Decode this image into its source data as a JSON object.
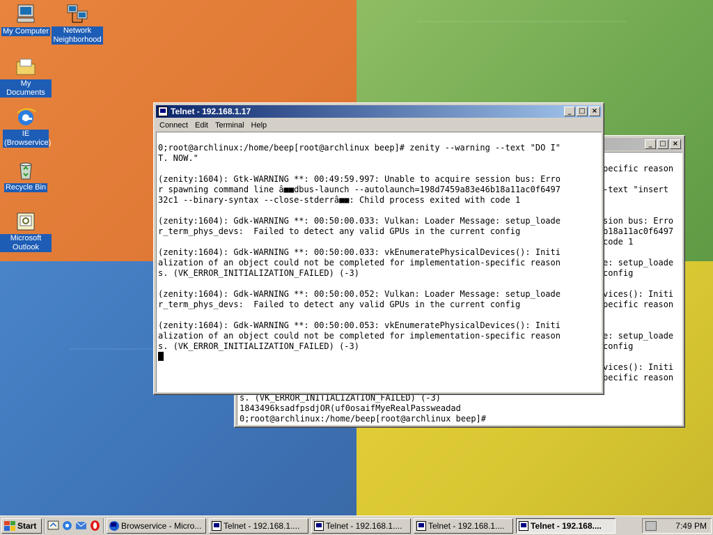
{
  "desktop": {
    "icons": [
      {
        "label": "My Computer"
      },
      {
        "label": "Network Neighborhood"
      },
      {
        "label": "My Documents"
      },
      {
        "label": "IE (Browservice)"
      },
      {
        "label": "Recycle Bin"
      },
      {
        "label": "Microsoft Outlook"
      }
    ]
  },
  "back_window": {
    "title": "",
    "lines": [
      "pecific reason",
      "",
      "-text \"insert",
      "",
      "",
      "sion bus: Erro",
      "b18a11ac0f6497",
      "code 1",
      "",
      "e: setup_loade",
      "config",
      "",
      "vices(): Initi",
      "pecific reason",
      "",
      "",
      "e: setup_loade",
      "config",
      "",
      "vices(): Initi",
      "pecific reason",
      "s. (VK_ERROR_INITIALIZATION_FAILED) (-3)",
      "1843496ksadfpsdjOR(uf0osaifMyeRealPassweadad",
      "0;root@archlinux:/home/beep[root@archlinux beep]#"
    ]
  },
  "front_window": {
    "title": "Telnet - 192.168.1.17",
    "menu": [
      "Connect",
      "Edit",
      "Terminal",
      "Help"
    ],
    "lines": [
      "",
      "0;root@archlinux:/home/beep[root@archlinux beep]# zenity --warning --text \"DO I\"",
      "T. NOW.\"",
      "",
      "(zenity:1604): Gtk-WARNING **: 00:49:59.997: Unable to acquire session bus: Erro",
      "r spawning command line â■■dbus-launch --autolaunch=198d7459a83e46b18a11ac0f6497",
      "32c1 --binary-syntax --close-stderrâ■■: Child process exited with code 1",
      "",
      "(zenity:1604): Gdk-WARNING **: 00:50:00.033: Vulkan: Loader Message: setup_loade",
      "r_term_phys_devs:  Failed to detect any valid GPUs in the current config",
      "",
      "(zenity:1604): Gdk-WARNING **: 00:50:00.033: vkEnumeratePhysicalDevices(): Initi",
      "alization of an object could not be completed for implementation-specific reason",
      "s. (VK_ERROR_INITIALIZATION_FAILED) (-3)",
      "",
      "(zenity:1604): Gdk-WARNING **: 00:50:00.052: Vulkan: Loader Message: setup_loade",
      "r_term_phys_devs:  Failed to detect any valid GPUs in the current config",
      "",
      "(zenity:1604): Gdk-WARNING **: 00:50:00.053: vkEnumeratePhysicalDevices(): Initi",
      "alization of an object could not be completed for implementation-specific reason",
      "s. (VK_ERROR_INITIALIZATION_FAILED) (-3)"
    ]
  },
  "taskbar": {
    "start_label": "Start",
    "tasks": [
      {
        "label": "Browservice - Micro...",
        "icon": "ie-icon"
      },
      {
        "label": "Telnet - 192.168.1....",
        "icon": "telnet-icon"
      },
      {
        "label": "Telnet - 192.168.1....",
        "icon": "telnet-icon"
      },
      {
        "label": "Telnet - 192.168.1....",
        "icon": "telnet-icon"
      },
      {
        "label": "Telnet - 192.168....",
        "icon": "telnet-icon"
      }
    ],
    "clock": "7:49 PM"
  }
}
